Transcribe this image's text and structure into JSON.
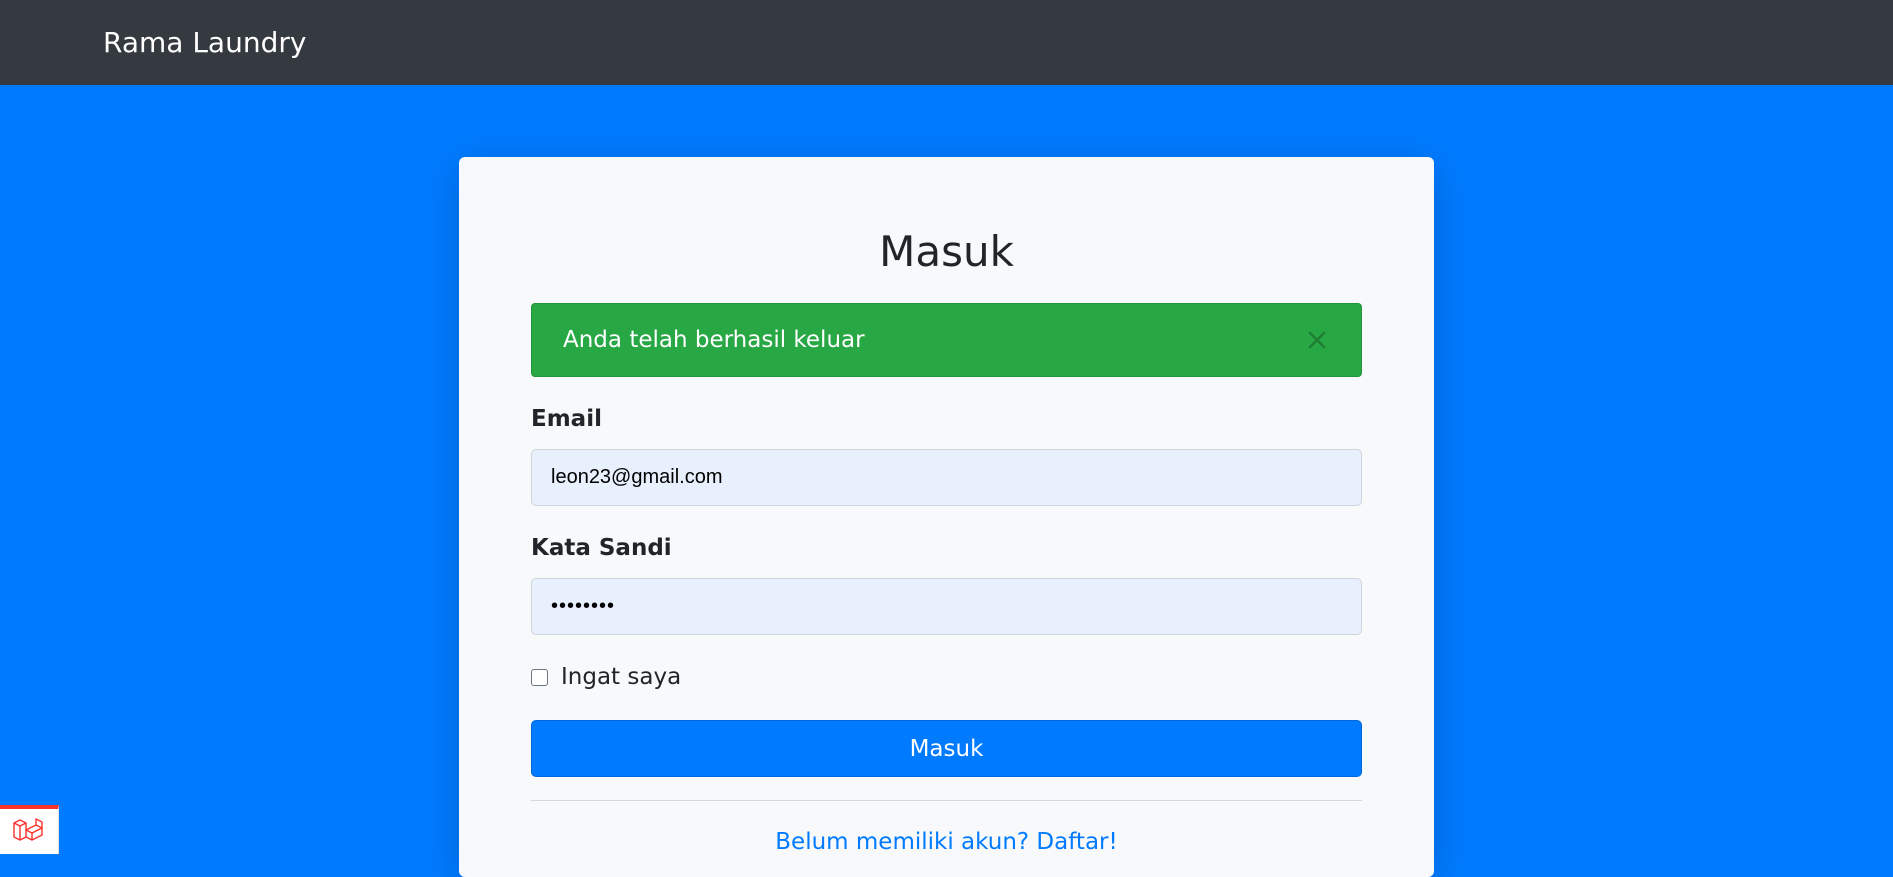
{
  "navbar": {
    "brand": "Rama Laundry"
  },
  "login": {
    "title": "Masuk",
    "alert": {
      "message": "Anda telah berhasil keluar",
      "close_icon": "close-icon"
    },
    "email": {
      "label": "Email",
      "value": "leon23@gmail.com"
    },
    "password": {
      "label": "Kata Sandi",
      "value": "••••••••"
    },
    "remember": {
      "label": "Ingat saya",
      "checked": false
    },
    "submit_label": "Masuk",
    "register_link": "Belum memiliki akun? Daftar!"
  },
  "debug_badge": {
    "icon": "laravel-icon"
  },
  "colors": {
    "navbar": "#343a40",
    "background": "#007bff",
    "success": "#28a745",
    "primary": "#007bff",
    "card": "#f8f9fa"
  }
}
